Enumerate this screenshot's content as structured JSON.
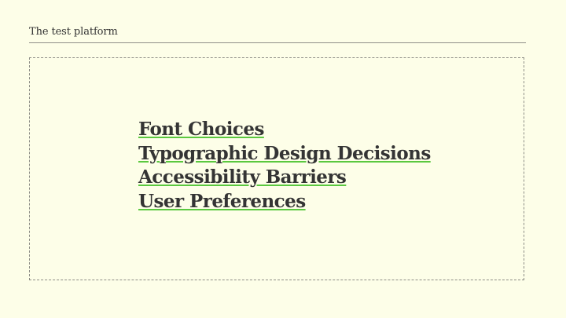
{
  "header": {
    "title": "The test platform"
  },
  "topics": [
    {
      "label": "Font Choices"
    },
    {
      "label": "Typographic Design Decisions"
    },
    {
      "label": "Accessibility Barriers"
    },
    {
      "label": "User Preferences"
    }
  ],
  "colors": {
    "background": "#fdfee8",
    "text": "#343434",
    "link_underline": "#5ac83f",
    "border": "#8d8d86"
  }
}
